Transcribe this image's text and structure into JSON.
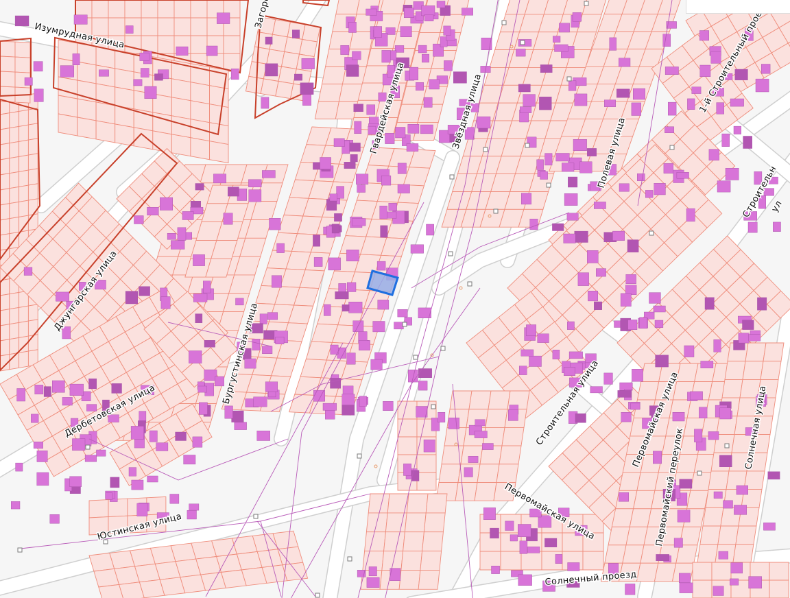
{
  "map": {
    "colors": {
      "background": "#f6f6f6",
      "road": "#ffffff",
      "road_edge": "#cfcfcf",
      "parcel_fill": "#fbe1de",
      "parcel_edge": "#ef8d7c",
      "quarter_edge": "#c8402a",
      "building": "#d874d8",
      "building_dark": "#b256b2",
      "utility_line": "#b85ab8",
      "selection_fill": "#96aee8",
      "selection_edge": "#1f6fe0",
      "marker_edge": "#7a7a7a"
    },
    "streets": [
      {
        "id": "izumrudnaya",
        "label": "Изумрудная улица"
      },
      {
        "id": "zagorodnaya",
        "label": "Загоро"
      },
      {
        "id": "gvardeyskaya",
        "label": "Гвардейская улица"
      },
      {
        "id": "zvezdnaya",
        "label": "Звёздная улица"
      },
      {
        "id": "stroitelny-1",
        "label": "1-й Строительный проезд"
      },
      {
        "id": "polevaya",
        "label": "Полевая улица"
      },
      {
        "id": "stroitelnaya-corner",
        "label": "Строительн"
      },
      {
        "id": "ul-corner",
        "label": "ул"
      },
      {
        "id": "dzhungarskaya",
        "label": "Джунгарская улица"
      },
      {
        "id": "burgustinskaya",
        "label": "Бургустинская улица"
      },
      {
        "id": "derbetovskaya",
        "label": "Дербетовская улица"
      },
      {
        "id": "stroitelnaya",
        "label": "Строительная улица"
      },
      {
        "id": "pervomayskaya-v",
        "label": "Первомайская улица"
      },
      {
        "id": "solnechnaya",
        "label": "Солнечная улица"
      },
      {
        "id": "pervomaysky-per",
        "label": "Первомайский переулок"
      },
      {
        "id": "pervomayskaya-h",
        "label": "Первомайская улица"
      },
      {
        "id": "yustinskaya",
        "label": "Юстинская улица"
      },
      {
        "id": "solnechny-proezd",
        "label": "Солнечный проезд"
      }
    ],
    "selected_parcel": {
      "highlighted": true
    }
  }
}
